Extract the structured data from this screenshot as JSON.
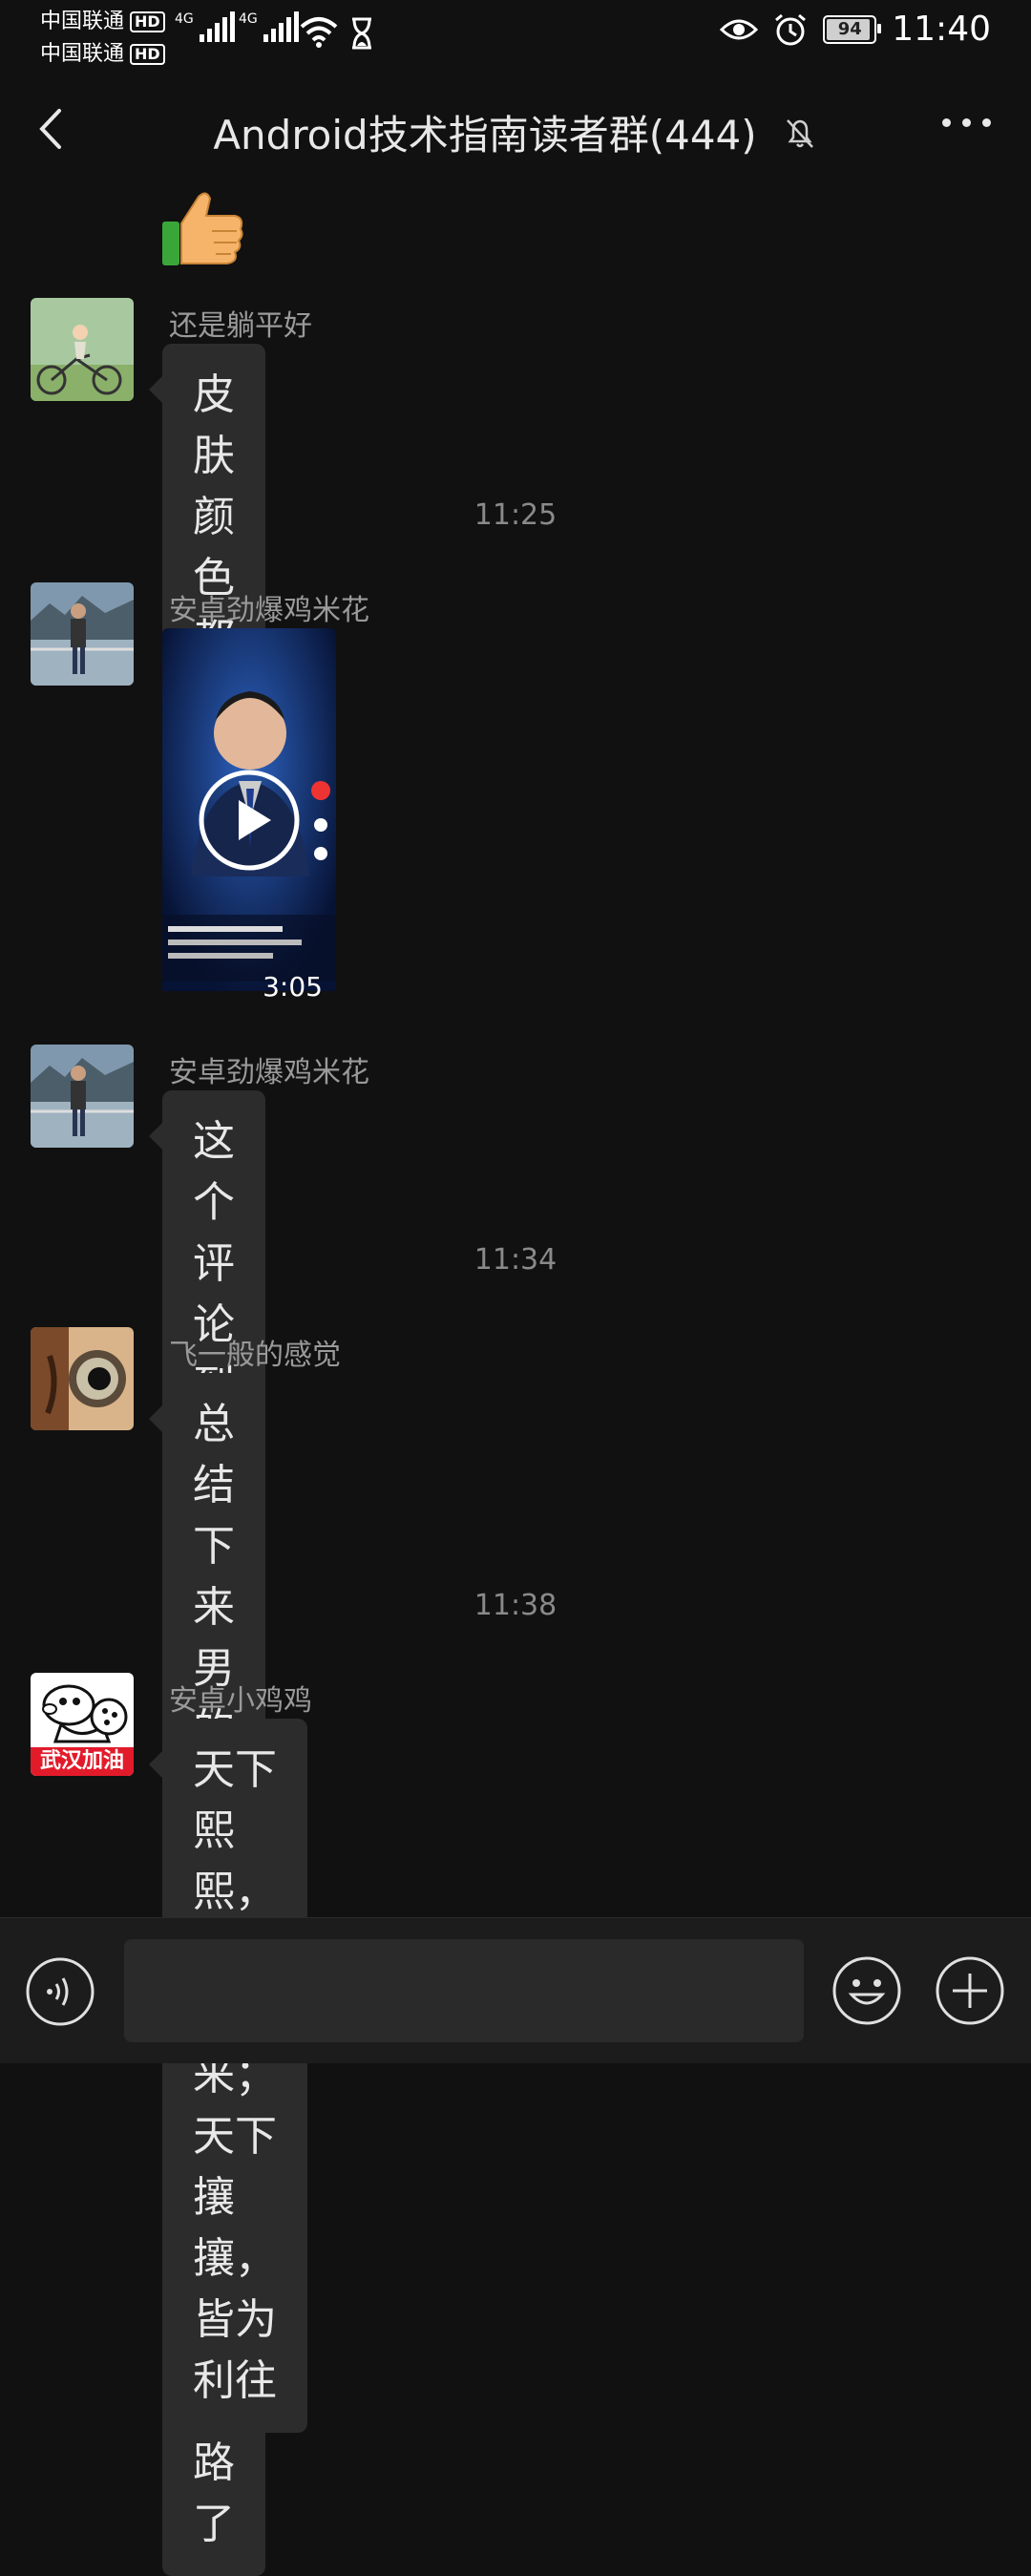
{
  "status_bar": {
    "carrier1": "中国联通",
    "carrier2": "中国联通",
    "hd": "HD",
    "network1": "4G",
    "network2": "4G",
    "battery": "94",
    "battery_level": 0.94,
    "time": "11:40"
  },
  "header": {
    "title": "Android技术指南读者群(444)",
    "back_icon": "chevron-left-icon",
    "mute_icon": "bell-off-icon",
    "more_icon": "more-dots-icon"
  },
  "messages": [
    {
      "type": "sticker",
      "icon": "thumbs-up-icon"
    },
    {
      "type": "text",
      "sender": "还是躺平好",
      "text": "皮肤颜色都不一样"
    },
    {
      "type": "time",
      "text": "11:25"
    },
    {
      "type": "video",
      "sender": "安卓劲爆鸡米花",
      "duration": "3:05"
    },
    {
      "type": "text",
      "sender": "安卓劲爆鸡米花",
      "text": "这个评论到位"
    },
    {
      "type": "time",
      "text": "11:34"
    },
    {
      "type": "text",
      "sender": "飞一般的感觉",
      "lines": [
        "总结下来 男的玩腻了 女的想报复",
        "钱被套路了"
      ]
    },
    {
      "type": "time",
      "text": "11:38"
    },
    {
      "type": "text",
      "sender": "安卓小鸡鸡",
      "avatar_text": "武汉加油",
      "lines": [
        "天下熙熙，皆为利来；天下攘攘，",
        "皆为利往"
      ]
    }
  ],
  "input_bar": {
    "voice_icon": "voice-icon",
    "emoji_icon": "emoji-icon",
    "plus_icon": "plus-icon"
  }
}
